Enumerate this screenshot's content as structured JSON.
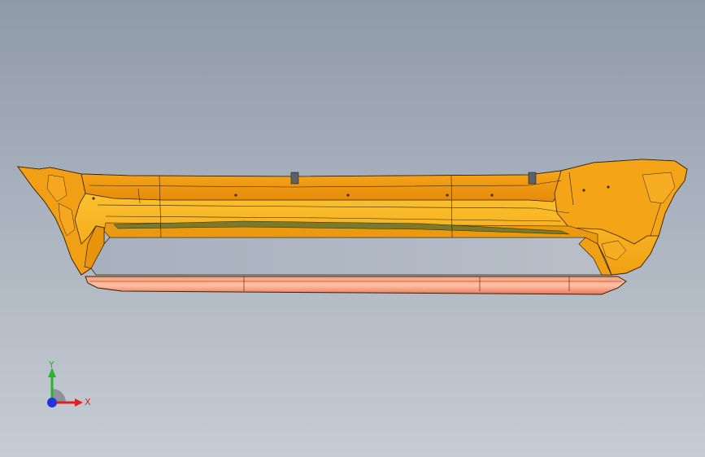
{
  "viewport": {
    "model": "bumper-part",
    "background_top": "#8f9aa9",
    "background_bottom": "#c6ccd3"
  },
  "part": {
    "body_color": "#f2a313",
    "body_highlight": "#ffc832",
    "shadow_color": "#c97800",
    "underside_color": "#f08a6e",
    "edge_color": "#3a2200"
  },
  "triad": {
    "x_label": "X",
    "y_label": "Y",
    "x_color": "#e02020",
    "y_color": "#2ab52a",
    "z_color": "#2233dd"
  }
}
